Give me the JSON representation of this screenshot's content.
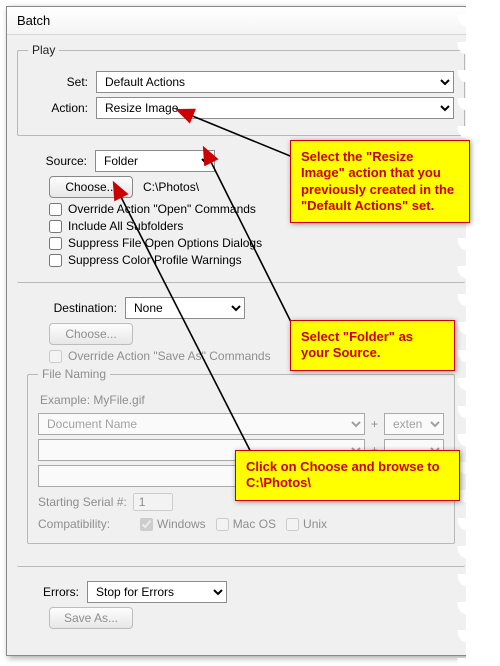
{
  "window": {
    "title": "Batch"
  },
  "play": {
    "legend": "Play",
    "set_label": "Set:",
    "set_value": "Default Actions",
    "action_label": "Action:",
    "action_value": "Resize Image"
  },
  "source": {
    "label": "Source:",
    "value": "Folder",
    "choose_btn": "Choose...",
    "path": "C:\\Photos\\",
    "override_open": "Override Action \"Open\" Commands",
    "include_subfolders": "Include All Subfolders",
    "suppress_open_dialogs": "Suppress File Open Options Dialogs",
    "suppress_color_warnings": "Suppress Color Profile Warnings"
  },
  "destination": {
    "label": "Destination:",
    "value": "None",
    "choose_btn": "Choose...",
    "override_saveas": "Override Action \"Save As\" Commands",
    "file_naming_legend": "File Naming",
    "example_label": "Example:",
    "example_value": "MyFile.gif",
    "doc_name_option": "Document Name",
    "extension_option": "extension",
    "serial_label": "Starting Serial #:",
    "serial_value": "1",
    "compat_label": "Compatibility:",
    "compat_windows": "Windows",
    "compat_mac": "Mac OS",
    "compat_unix": "Unix"
  },
  "errors": {
    "label": "Errors:",
    "value": "Stop for Errors",
    "saveas_btn": "Save As..."
  },
  "callouts": {
    "c1": "Select the \"Resize Image\" action that you previously created in the \"Default Actions\" set.",
    "c2": "Select \"Folder\" as your Source.",
    "c3": "Click on Choose and browse to C:\\Photos\\"
  }
}
